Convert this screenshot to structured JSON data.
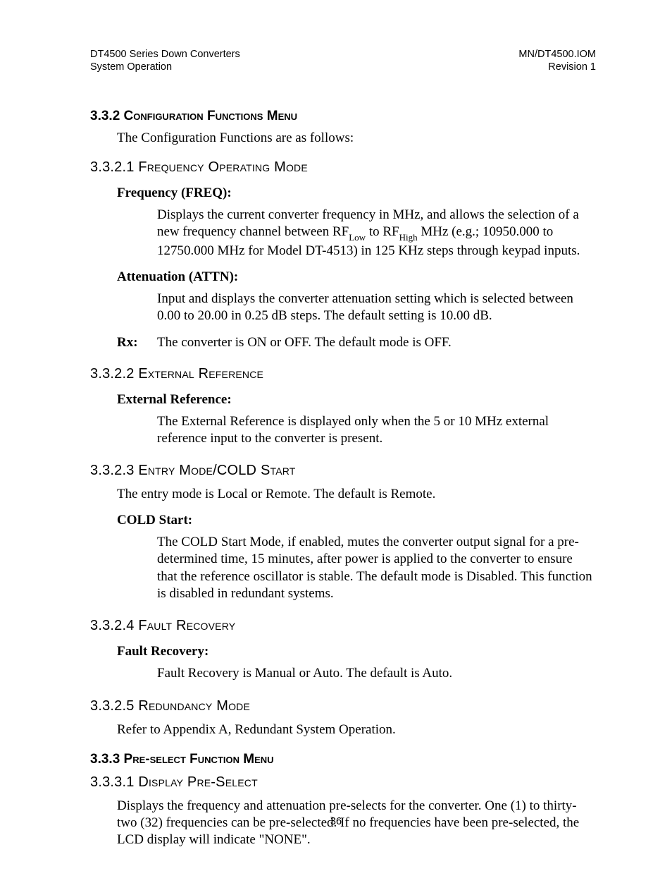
{
  "header": {
    "left_line1": "DT4500 Series Down Converters",
    "left_line2": "System Operation",
    "right_line1": "MN/DT4500.IOM",
    "right_line2": "Revision 1"
  },
  "s332": {
    "num": "3.3.2",
    "title": "Configuration Functions Menu",
    "intro": "The Configuration Functions are as follows:"
  },
  "s3321": {
    "num": "3.3.2.1",
    "title": "Frequency Operating Mode",
    "freq_term": "Frequency (FREQ):",
    "freq_body_1a": "Displays the current converter frequency in MHz, and allows the selection of a new frequency channel between RF",
    "freq_sub_low": "Low",
    "freq_body_1b": " to RF",
    "freq_sub_high": "High",
    "freq_body_1c": " MHz (e.g.; 10950.000 to 12750.000 MHz for Model DT-4513) in 125 KHz steps through keypad inputs.",
    "attn_term": "Attenuation (ATTN):",
    "attn_body": "Input and displays the converter attenuation setting which is selected between 0.00 to 20.00 in 0.25 dB steps.  The default setting is 10.00 dB.",
    "rx_label": "Rx:",
    "rx_body": "The converter is ON or OFF.  The default mode is OFF."
  },
  "s3322": {
    "num": "3.3.2.2",
    "title": "External Reference",
    "term": "External Reference:",
    "body": "The External Reference is displayed only when the 5 or 10 MHz external reference input to the converter is present."
  },
  "s3323": {
    "num": "3.3.2.3",
    "title": "Entry Mode/COLD Start",
    "intro": "The entry mode is Local or Remote.  The default is Remote.",
    "term": "COLD Start:",
    "body": "The COLD Start Mode, if enabled, mutes the converter output signal for a pre-determined time, 15 minutes, after power is applied to the converter to ensure that the reference oscillator is stable.  The default mode is Disabled. This function is disabled in redundant systems."
  },
  "s3324": {
    "num": "3.3.2.4",
    "title": "Fault Recovery",
    "term": "Fault Recovery:",
    "body": "Fault Recovery is Manual or Auto.  The default is Auto."
  },
  "s3325": {
    "num": "3.3.2.5",
    "title": "Redundancy Mode",
    "body": "Refer to Appendix A, Redundant System Operation."
  },
  "s333": {
    "num": "3.3.3",
    "title": "Pre-select Function Menu"
  },
  "s3331": {
    "num": "3.3.3.1",
    "title": "Display Pre-Select",
    "body": "Displays the frequency and attenuation pre-selects for the converter.  One (1) to thirty-two (32) frequencies can be pre-selected.  If no frequencies have been pre-selected, the LCD display will indicate \"NONE\"."
  },
  "page_number": "36"
}
